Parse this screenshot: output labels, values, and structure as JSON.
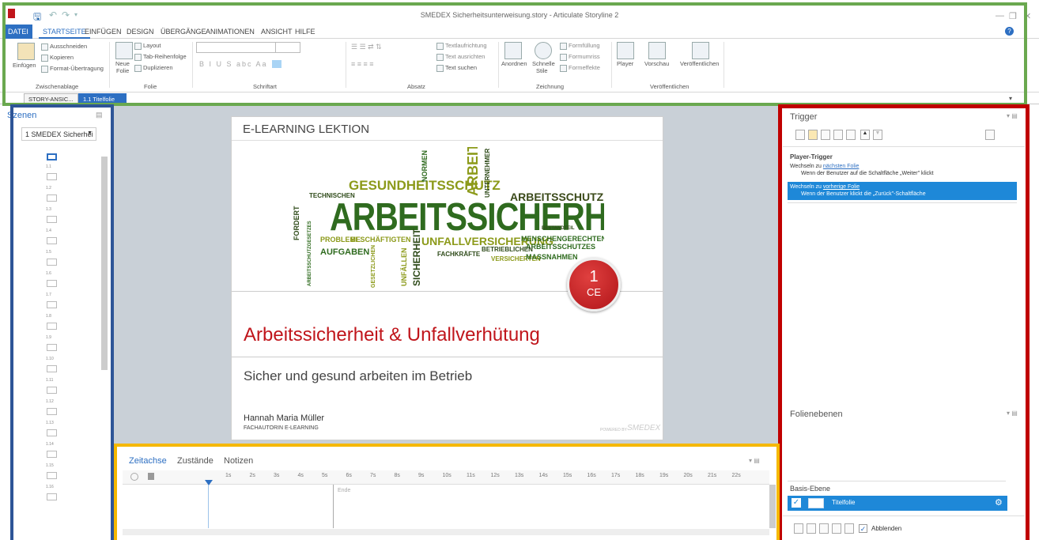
{
  "window": {
    "title": "SMEDEX Sicherheitsunterweisung.story - Articulate Storyline 2"
  },
  "qat": {
    "save_icon": "save-icon",
    "undo_icon": "undo-icon",
    "redo_icon": "redo-icon"
  },
  "tabs": [
    "DATEI",
    "STARTSEITE",
    "EINFÜGEN",
    "DESIGN",
    "ÜBERGÄNGE",
    "ANIMATIONEN",
    "ANSICHT",
    "HILFE"
  ],
  "ribbon": {
    "clipboard": {
      "paste": "Einfügen",
      "cut": "Ausschneiden",
      "copy": "Kopieren",
      "format": "Format-Übertragung",
      "group": "Zwischenablage"
    },
    "slide": {
      "new1": "Neue",
      "new2": "Folie",
      "layout": "Layout",
      "taborder": "Tab-Reihenfolge",
      "duplicate": "Duplizieren",
      "group": "Folie"
    },
    "font": {
      "group": "Schriftart",
      "aa": "Aa"
    },
    "paragraph": {
      "textdir": "Textlaufrichtung",
      "align": "Text ausrichten",
      "find": "Text suchen",
      "group": "Absatz"
    },
    "drawing": {
      "arrange": "Anordnen",
      "quick1": "Schnelle",
      "quick2": "Stile",
      "fill": "Formfüllung",
      "outline": "Formumriss",
      "effects": "Formeffekte",
      "group": "Zeichnung"
    },
    "publish": {
      "player": "Player",
      "preview": "Vorschau",
      "publish": "Veröffentlichen",
      "group": "Veröffentlichen"
    }
  },
  "doctabs": [
    "STORY-ANSIC...",
    "1.1 Titelfolie"
  ],
  "scenes": {
    "title": "Szenen",
    "select": "1 SMEDEX Sicherhei",
    "numbers": [
      "1.1",
      "1.2",
      "1.3",
      "1.4",
      "1.5",
      "1.6",
      "1.7",
      "1.8",
      "1.9",
      "1.10",
      "1.11",
      "1.12",
      "1.13",
      "1.14",
      "1.15",
      "1.16"
    ]
  },
  "slide": {
    "header": "E-LEARNING LEKTION",
    "title": "Arbeitssicherheit & Unfallverhütung",
    "subtitle": "Sicher und gesund arbeiten im Betrieb",
    "author": "Hannah Maria Müller",
    "author_role": "FACHAUTORIN E-LEARNING",
    "badge_num": "1",
    "badge_txt": "CE",
    "powered": "POWERED BY",
    "brand": "SMEDEX",
    "words": [
      "ARBEITSSICHERHEIT",
      "GESUNDHEITSSCHUTZ",
      "ARBEITSSCHUTZ",
      "UNFALLVERSICHERUNG",
      "PROBLEME",
      "BESCHÄFTIGTEN",
      "AUFGABEN",
      "TECHNISCHEN",
      "FORDERT",
      "ARBEIT",
      "NORMEN",
      "UNTERNEHMER",
      "SICHERHEIT",
      "MENSCHENGERECHTEN",
      "ARBEITSSCHUTZES",
      "BETRIEBLICHEN",
      "FACHKRÄFTE",
      "VERSICHERTEN",
      "MASSNAHMEN",
      "ARBEITSSCHUTZGESETZES",
      "BESTANDTEIL",
      "UNFÄLLEN",
      "GESETZLICHEN"
    ]
  },
  "timeline": {
    "tabs": [
      "Zeitachse",
      "Zustände",
      "Notizen"
    ],
    "ticks": [
      "1s",
      "2s",
      "3s",
      "4s",
      "5s",
      "6s",
      "7s",
      "8s",
      "9s",
      "10s",
      "11s",
      "12s",
      "13s",
      "14s",
      "15s",
      "16s",
      "17s",
      "18s",
      "19s",
      "20s",
      "21s",
      "22s"
    ],
    "end_label": "Ende"
  },
  "trigger": {
    "title": "Trigger",
    "section": "Player-Trigger",
    "items": [
      {
        "pre": "Wechseln zu ",
        "link": "nächsten Folie",
        "cond": "Wenn der Benutzer auf die Schaltfläche „Weiter\" klickt"
      },
      {
        "pre": "Wechseln zu ",
        "link": "vorherige Folie",
        "cond": "Wenn der Benutzer klickt die „Zurück\"-Schaltfläche"
      }
    ]
  },
  "layers": {
    "title": "Folienebenen",
    "base": "Basis-Ebene",
    "slide_layer": "Titelfolie",
    "hide": "Abblenden"
  },
  "colors": {
    "accent": "#2d6fc2",
    "green_frame": "#6aa84f",
    "blue_frame": "#2e5597",
    "red_frame": "#c00000",
    "yellow_frame": "#f5b800",
    "title_red": "#c0151b"
  }
}
